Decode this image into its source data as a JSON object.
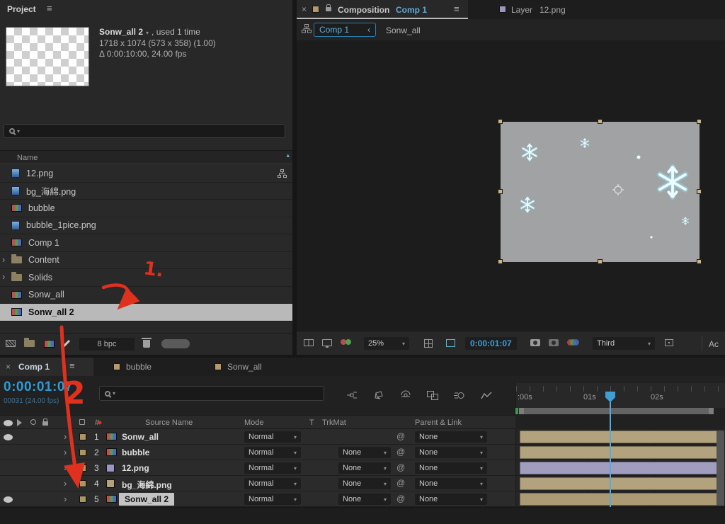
{
  "colors": {
    "accent_cyan": "#3f9ed8",
    "selection_gray": "#b9b9b9",
    "bar_tan": "#b3a27e",
    "bar_lavender": "#a09dbf",
    "annotation_red": "#e0301e"
  },
  "project_panel": {
    "title": "Project",
    "selected_item": {
      "name": "Sonw_all 2",
      "usage": ", used 1 time",
      "dimensions": "1718 x 1074  (573 x 358)  (1.00)",
      "duration": "Δ 0:00:10:00, 24.00 fps"
    },
    "name_column": "Name",
    "items": [
      {
        "label": "12.png",
        "type": "footage",
        "has_usage_icon": true
      },
      {
        "label": "bg_海綿.png",
        "type": "footage"
      },
      {
        "label": "bubble",
        "type": "comp"
      },
      {
        "label": "bubble_1pice.png",
        "type": "footage"
      },
      {
        "label": "Comp 1",
        "type": "comp"
      },
      {
        "label": "Content",
        "type": "folder"
      },
      {
        "label": "Solids",
        "type": "folder"
      },
      {
        "label": "Sonw_all",
        "type": "comp"
      },
      {
        "label": "Sonw_all 2",
        "type": "comp",
        "selected": true
      }
    ],
    "footer": {
      "color_depth": "8 bpc"
    }
  },
  "composition_panel": {
    "tabs": [
      {
        "kind": "Composition",
        "name": "Comp 1",
        "active": true
      },
      {
        "kind": "Layer",
        "name": "12.png",
        "active": false
      }
    ],
    "breadcrumb": {
      "current": "Comp 1",
      "back_chevron": "‹",
      "layer_name": "Sonw_all"
    },
    "toolbar": {
      "zoom": "25%",
      "timecode": "0:00:01:07",
      "resolution": "Third",
      "camera_label": "Ac"
    }
  },
  "timeline_panel": {
    "tabs": [
      {
        "name": "Comp 1",
        "active": true
      },
      {
        "name": "bubble",
        "active": false
      },
      {
        "name": "Sonw_all",
        "active": false
      }
    ],
    "timecode": "0:00:01:07",
    "frame_info": "00031 (24.00 fps)",
    "columns": {
      "source_name": "Source Name",
      "mode": "Mode",
      "t": "T",
      "trkmat": "TrkMat",
      "parent": "Parent & Link"
    },
    "ruler_labels": [
      ":00s",
      "01s",
      "02s"
    ],
    "layers": [
      {
        "num": "1",
        "name": "Sonw_all",
        "mode": "Normal",
        "trkmat": "",
        "parent": "None",
        "bar_color": "#b3a27e",
        "visible": true,
        "icon": "comp"
      },
      {
        "num": "2",
        "name": "bubble",
        "mode": "Normal",
        "trkmat": "None",
        "parent": "None",
        "bar_color": "#b3a27e",
        "visible": false,
        "icon": "comp"
      },
      {
        "num": "3",
        "name": "12.png",
        "mode": "Normal",
        "trkmat": "None",
        "parent": "None",
        "bar_color": "#a09dbf",
        "visible": false,
        "icon": "footage-purple"
      },
      {
        "num": "4",
        "name": "bg_海綿.png",
        "mode": "Normal",
        "trkmat": "None",
        "parent": "None",
        "bar_color": "#b3a27e",
        "visible": false,
        "icon": "footage-tan"
      },
      {
        "num": "5",
        "name": "Sonw_all 2",
        "mode": "Normal",
        "trkmat": "None",
        "parent": "None",
        "bar_color": "#ab9a73",
        "visible": true,
        "icon": "comp",
        "selected": true
      }
    ]
  },
  "annotations": {
    "mark_1": "1.",
    "mark_2": "2"
  }
}
